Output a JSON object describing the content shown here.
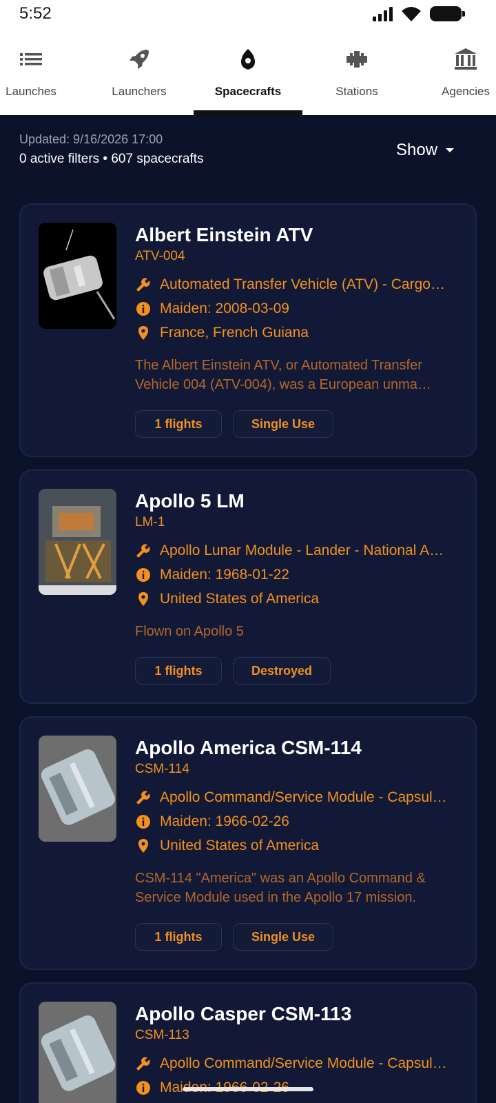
{
  "status_bar": {
    "time": "5:52"
  },
  "tabs": [
    {
      "label": "Launches",
      "icon": "list-icon"
    },
    {
      "label": "Launchers",
      "icon": "rocket-icon"
    },
    {
      "label": "Spacecrafts",
      "icon": "capsule-icon",
      "active": true
    },
    {
      "label": "Stations",
      "icon": "satellite-icon"
    },
    {
      "label": "Agencies",
      "icon": "building-icon"
    }
  ],
  "info": {
    "updated": "Updated: 9/16/2026 17:00",
    "filters": "0 active filters • 607 spacecrafts",
    "show_label": "Show"
  },
  "cards": [
    {
      "title": "Albert Einstein ATV",
      "serial": "ATV-004",
      "config": "Automated Transfer Vehicle (ATV) - Cargo…",
      "maiden": "Maiden: 2008-03-09",
      "location": "France, French Guiana",
      "description": "The Albert Einstein ATV, or Automated Transfer Vehicle 004 (ATV-004), was a European unma…",
      "flights": "1 flights",
      "status": "Single Use"
    },
    {
      "title": "Apollo 5 LM",
      "serial": "LM-1",
      "config": "Apollo Lunar Module - Lander - National A…",
      "maiden": "Maiden: 1968-01-22",
      "location": "United States of America",
      "description": "Flown on Apollo 5",
      "flights": "1 flights",
      "status": "Destroyed"
    },
    {
      "title": "Apollo America CSM-114",
      "serial": "CSM-114",
      "config": "Apollo Command/Service Module - Capsul…",
      "maiden": "Maiden: 1966-02-26",
      "location": "United States of America",
      "description": "CSM-114 \"America\" was an Apollo Command & Service Module used in the Apollo 17 mission.",
      "flights": "1 flights",
      "status": "Single Use"
    },
    {
      "title": "Apollo Casper CSM-113",
      "serial": "CSM-113",
      "config": "Apollo Command/Service Module - Capsul…",
      "maiden": "Maiden: 1966-02-26"
    }
  ],
  "colors": {
    "accent": "#f3901e",
    "background": "#0b132b",
    "card": "#111936"
  }
}
